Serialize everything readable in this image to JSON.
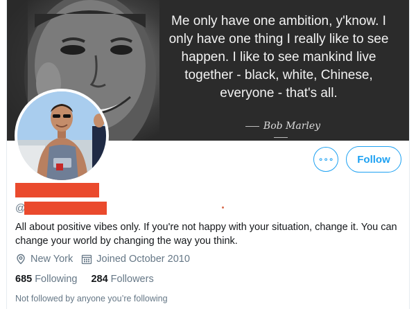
{
  "banner": {
    "quote": "Me only have one ambition, y'know. I only have one thing I really like to see happen. I like to see mankind live together - black, white, Chinese, everyone - that's all.",
    "author": "Bob Marley"
  },
  "actions": {
    "more_label": "∘∘∘",
    "follow_label": "Follow"
  },
  "profile": {
    "handle_prefix": "@",
    "bio": "All about positive vibes only. If you're not happy with your situation, change it. You can change your world by changing the way you think.",
    "location": "New York",
    "joined": "Joined October 2010",
    "following_count": "685",
    "following_label": "Following",
    "followers_count": "284",
    "followers_label": "Followers",
    "not_followed_text": "Not followed by anyone you’re following"
  },
  "colors": {
    "accent": "#1da1f2",
    "redaction": "#ea4a2d",
    "secondary_text": "#657786"
  },
  "icons": {
    "location": "location-pin-icon",
    "calendar": "calendar-icon",
    "more": "more-options-icon"
  }
}
